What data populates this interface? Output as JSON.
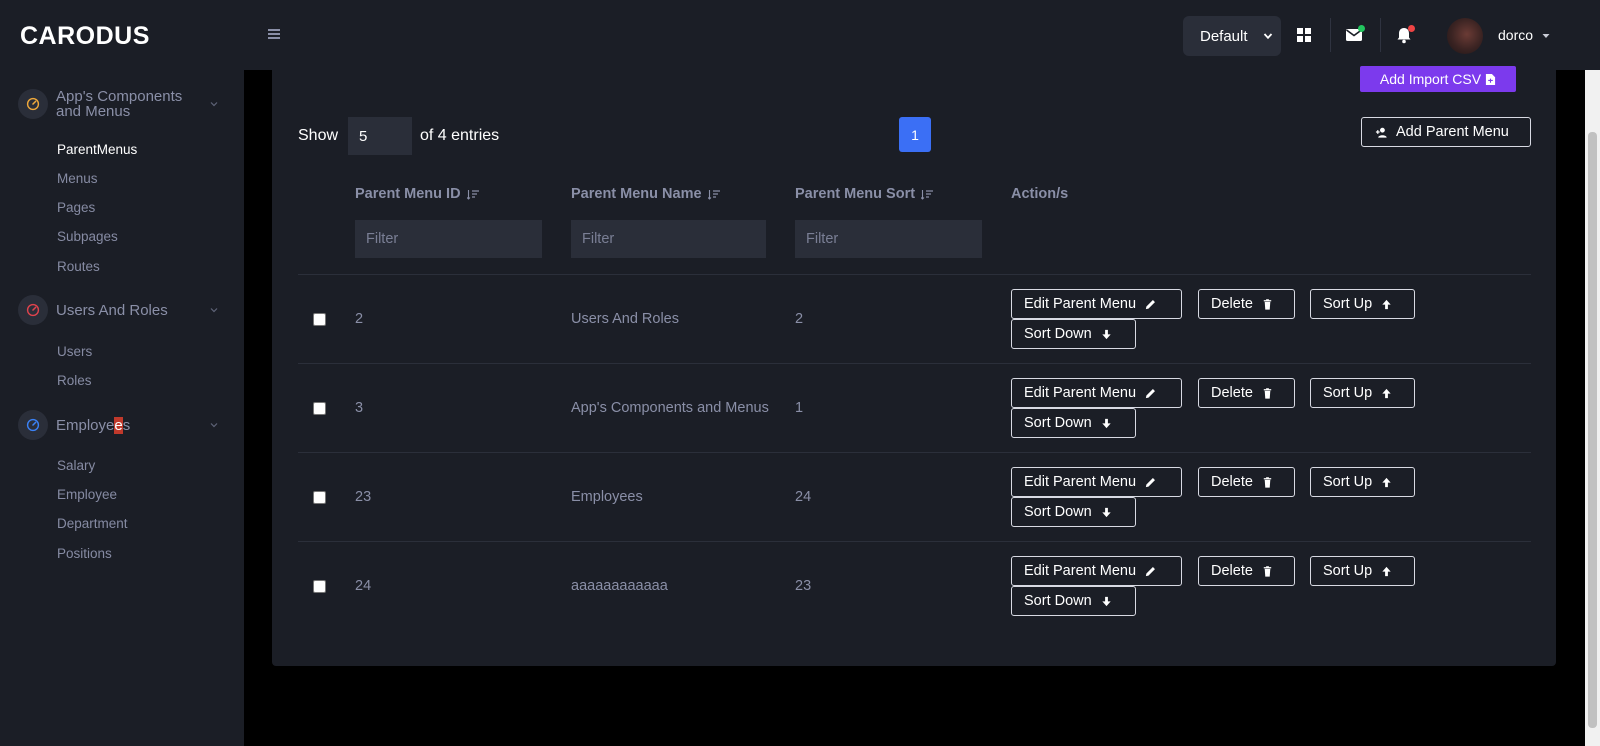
{
  "app": {
    "brand": "CARODUS"
  },
  "sidebar": {
    "groups": [
      {
        "label": "App's Components and Menus",
        "icon": "gauge-icon",
        "color": "#f0a93b"
      },
      {
        "label": "Users And Roles",
        "icon": "gauge-icon",
        "color": "#e0434d"
      },
      {
        "label_before": "Employe",
        "label_highlight": "e",
        "label_after": "s",
        "icon": "gauge-icon",
        "color": "#3b82f6"
      }
    ],
    "items": {
      "components": [
        "ParentMenus",
        "Menus",
        "Pages",
        "Subpages",
        "Routes"
      ],
      "users": [
        "Users",
        "Roles"
      ],
      "employees": [
        "Salary",
        "Employee",
        "Department",
        "Positions"
      ]
    }
  },
  "header": {
    "theme": "Default",
    "username": "dorco",
    "icons": [
      "menu-icon",
      "grid-icon",
      "mail-icon",
      "bell-icon"
    ],
    "mail_dot_color": "#22c55e",
    "bell_dot_color": "#ef4444"
  },
  "toolbar": {
    "import_csv": "Add Import CSV",
    "show": "Show",
    "page_size": "5",
    "entries": "of 4 entries",
    "page": "1",
    "add_parent": "Add Parent Menu"
  },
  "table": {
    "headers": [
      "Parent Menu ID",
      "Parent Menu Name",
      "Parent Menu Sort",
      "Action/s"
    ],
    "filter_placeholder": "Filter",
    "rows": [
      {
        "id": "2",
        "name": "Users And Roles",
        "sort": "2"
      },
      {
        "id": "3",
        "name": "App's Components and Menus",
        "sort": "1"
      },
      {
        "id": "23",
        "name": "Employees",
        "sort": "24"
      },
      {
        "id": "24",
        "name": "aaaaaaaaaaaa",
        "sort": "23"
      }
    ],
    "actions": {
      "edit": "Edit Parent Menu",
      "delete": "Delete",
      "sort_up": "Sort Up",
      "sort_down": "Sort Down"
    }
  },
  "colors": {
    "accent": "#3b6ff5",
    "purple": "#7c3aed",
    "panel": "#1b1e26",
    "input": "#2a2e39"
  }
}
